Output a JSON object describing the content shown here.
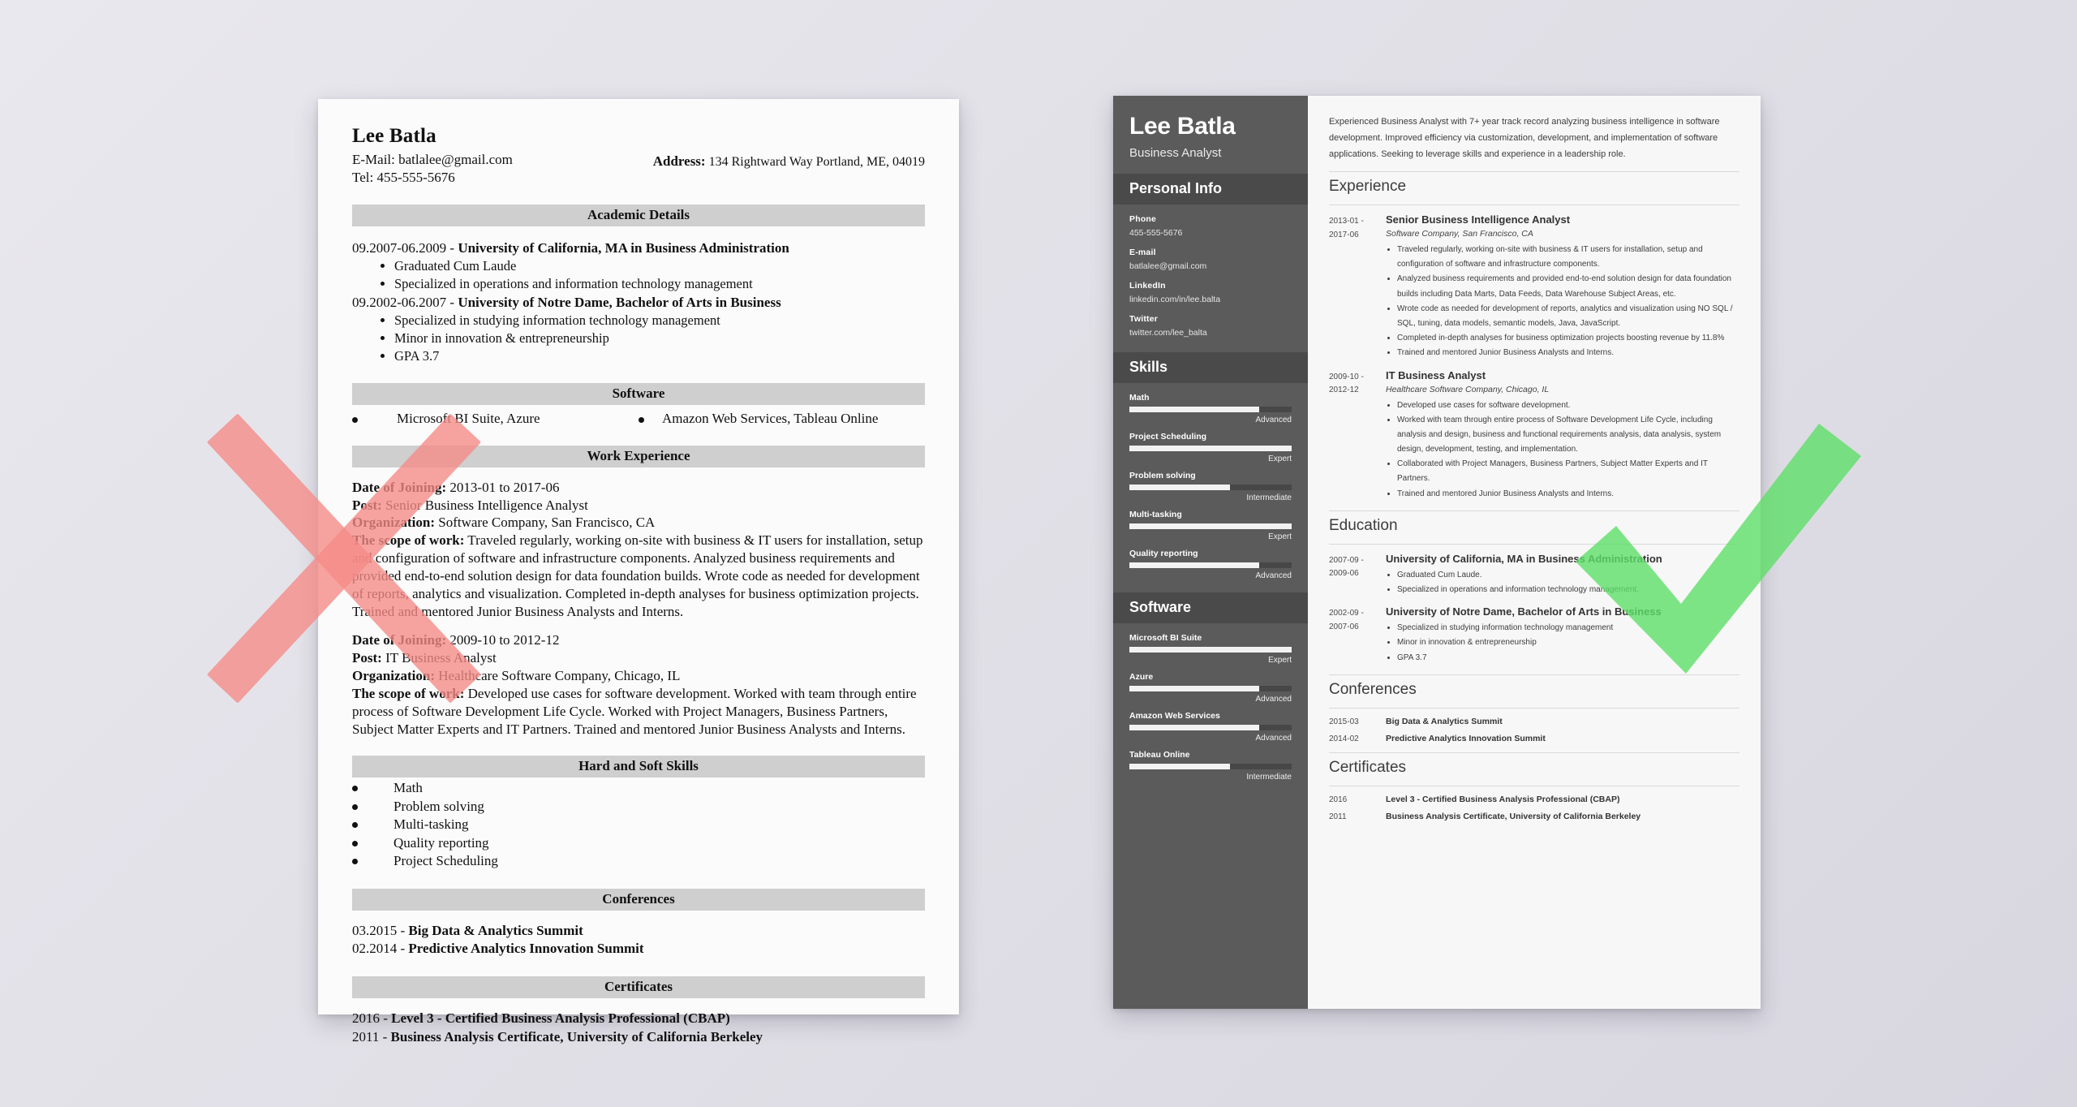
{
  "colors": {
    "background_start": "#e9e8ee",
    "background_end": "#d8d6df",
    "x_mark": "#f58a86",
    "check_mark": "#5ede68",
    "sidebar": "#5b5b5b",
    "sidebar_bar": "#4a4a4a",
    "section_bar_left": "#cfcfcf"
  },
  "marks": {
    "bad_icon": "x-mark-icon",
    "good_icon": "check-mark-icon"
  },
  "bad_resume": {
    "name": "Lee Batla",
    "email_line": "E-Mail: batlalee@gmail.com",
    "tel_line": "Tel: 455-555-5676",
    "address_label": "Address:",
    "address_value": "134 Rightward Way Portland, ME, 04019",
    "sections": {
      "academic": "Academic Details",
      "software": "Software",
      "work": "Work Experience",
      "skills": "Hard and Soft Skills",
      "conferences": "Conferences",
      "certificates": "Certificates"
    },
    "education": [
      {
        "head_date": "09.2007-06.2009 - ",
        "head_title": "University of California, MA in Business Administration",
        "bullets": [
          "Graduated Cum Laude",
          "Specialized in operations and information technology management"
        ]
      },
      {
        "head_date": "09.2002-06.2007 - ",
        "head_title": "University of Notre Dame, Bachelor of Arts in Business",
        "bullets": [
          "Specialized in studying information technology management",
          "Minor in innovation & entrepreneurship",
          "GPA 3.7"
        ]
      }
    ],
    "software_items": [
      "Microsoft BI Suite, Azure",
      "Amazon Web Services, Tableau Online"
    ],
    "jobs": [
      {
        "date_label": "Date of Joining:",
        "date_value": " 2013-01 to 2017-06",
        "post_label": "Post:",
        "post_value": " Senior Business Intelligence Analyst",
        "org_label": "Organization:",
        "org_value": " Software Company, San Francisco, CA",
        "scope_label": "The scope of work:",
        "scope_value": " Traveled regularly, working on-site with business & IT users for installation, setup and configuration of software and infrastructure components. Analyzed business requirements and provided end-to-end solution design for data foundation builds. Wrote code as needed for development of reports, analytics and visualization. Completed in-depth analyses for business optimization projects. Trained and mentored Junior Business Analysts and Interns."
      },
      {
        "date_label": "Date of Joining:",
        "date_value": " 2009-10 to 2012-12",
        "post_label": "Post:",
        "post_value": " IT Business Analyst",
        "org_label": "Organization:",
        "org_value": " Healthcare Software Company, Chicago, IL",
        "scope_label": "The scope of work:",
        "scope_value": " Developed use cases for software development. Worked with team through entire process of Software Development Life Cycle. Worked with Project Managers, Business Partners, Subject Matter Experts and IT Partners. Trained and mentored Junior Business Analysts and Interns."
      }
    ],
    "skills": [
      "Math",
      "Problem solving",
      "Multi-tasking",
      "Quality reporting",
      "Project Scheduling"
    ],
    "conferences": [
      {
        "date": "03.2015 - ",
        "title": "Big Data & Analytics Summit"
      },
      {
        "date": "02.2014 - ",
        "title": "Predictive Analytics Innovation Summit"
      }
    ],
    "certificates": [
      {
        "date": "2016 - ",
        "title": "Level 3 - Certified Business Analysis Professional (CBAP)"
      },
      {
        "date": "2011 - ",
        "title": "Business Analysis Certificate, University of California Berkeley"
      }
    ]
  },
  "good_resume": {
    "sidebar": {
      "name": "Lee Batla",
      "job_title": "Business Analyst",
      "personal_info_heading": "Personal Info",
      "contacts": [
        {
          "label": "Phone",
          "value": "455-555-5676"
        },
        {
          "label": "E-mail",
          "value": "batlalee@gmail.com"
        },
        {
          "label": "LinkedIn",
          "value": "linkedin.com/in/lee.balta"
        },
        {
          "label": "Twitter",
          "value": "twitter.com/lee_balta"
        }
      ],
      "skills_heading": "Skills",
      "skills": [
        {
          "name": "Math",
          "level": "Advanced",
          "pct": 80
        },
        {
          "name": "Project Scheduling",
          "level": "Expert",
          "pct": 100
        },
        {
          "name": "Problem solving",
          "level": "Intermediate",
          "pct": 62
        },
        {
          "name": "Multi-tasking",
          "level": "Expert",
          "pct": 100
        },
        {
          "name": "Quality reporting",
          "level": "Advanced",
          "pct": 80
        }
      ],
      "software_heading": "Software",
      "software": [
        {
          "name": "Microsoft BI Suite",
          "level": "Expert",
          "pct": 100
        },
        {
          "name": "Azure",
          "level": "Advanced",
          "pct": 80
        },
        {
          "name": "Amazon Web Services",
          "level": "Advanced",
          "pct": 80
        },
        {
          "name": "Tableau Online",
          "level": "Intermediate",
          "pct": 62
        }
      ]
    },
    "main": {
      "summary": "Experienced Business Analyst with 7+ year track record analyzing business intelligence in software development. Improved efficiency via customization, development, and implementation of software applications. Seeking to leverage skills and experience in a leadership role.",
      "experience_heading": "Experience",
      "experience": [
        {
          "date": "2013-01 - 2017-06",
          "role": "Senior Business Intelligence Analyst",
          "org": "Software Company, San Francisco, CA",
          "bullets": [
            "Traveled regularly, working on-site with business & IT users for installation, setup and configuration of software and infrastructure components.",
            "Analyzed business requirements and provided end-to-end solution design for data foundation builds including Data Marts, Data Feeds, Data Warehouse Subject Areas, etc.",
            "Wrote code as needed for development of reports, analytics and visualization using NO SQL / SQL, tuning, data models, semantic models, Java, JavaScript.",
            "Completed in-depth analyses for business optimization projects boosting revenue by 11.8%",
            "Trained and mentored Junior Business Analysts and Interns."
          ]
        },
        {
          "date": "2009-10 - 2012-12",
          "role": "IT Business Analyst",
          "org": "Healthcare Software Company, Chicago, IL",
          "bullets": [
            "Developed use cases for software development.",
            "Worked with team through entire process of Software Development Life Cycle, including analysis and design, business and functional requirements analysis, data analysis, system design, development, testing, and implementation.",
            "Collaborated with Project Managers, Business Partners, Subject Matter Experts and IT Partners.",
            "Trained and mentored Junior Business Analysts and Interns."
          ]
        }
      ],
      "education_heading": "Education",
      "education": [
        {
          "date": "2007-09 - 2009-06",
          "school": "University of California, MA in Business Administration",
          "bullets": [
            "Graduated Cum Laude.",
            "Specialized in operations and information technology management."
          ]
        },
        {
          "date": "2002-09 - 2007-06",
          "school": "University of Notre Dame, Bachelor of Arts in Business",
          "bullets": [
            "Specialized in studying information technology management",
            "Minor in innovation & entrepreneurship",
            "GPA 3.7"
          ]
        }
      ],
      "conferences_heading": "Conferences",
      "conferences": [
        {
          "date": "2015-03",
          "title": "Big Data & Analytics Summit"
        },
        {
          "date": "2014-02",
          "title": "Predictive Analytics Innovation Summit"
        }
      ],
      "certificates_heading": "Certificates",
      "certificates": [
        {
          "date": "2016",
          "title": "Level 3 - Certified Business Analysis Professional (CBAP)"
        },
        {
          "date": "2011",
          "title": "Business Analysis Certificate, University of California Berkeley"
        }
      ]
    }
  }
}
